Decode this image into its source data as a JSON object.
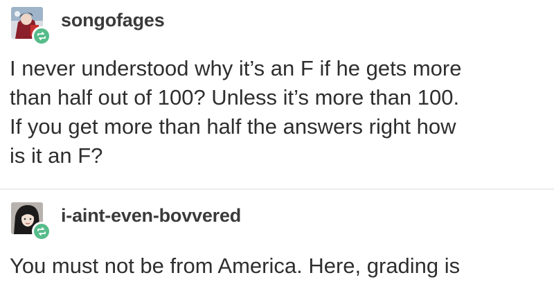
{
  "posts": [
    {
      "username": "songofages",
      "avatar_icon": "user-avatar-icon",
      "badge_icon": "reblog-icon",
      "lines": [
        "I never understood why it’s an F if he gets more",
        "than half out of 100? Unless it’s more than 100.",
        "If you get more than half the answers right how",
        "is it an F?"
      ]
    },
    {
      "username": "i-aint-even-bovvered",
      "avatar_icon": "user-avatar-icon",
      "badge_icon": "reblog-icon",
      "lines": [
        "You must not be from America. Here, grading is"
      ]
    }
  ],
  "colors": {
    "reblog_badge": "#56bc8a",
    "text": "#2e2e2e",
    "divider": "#ececec"
  }
}
